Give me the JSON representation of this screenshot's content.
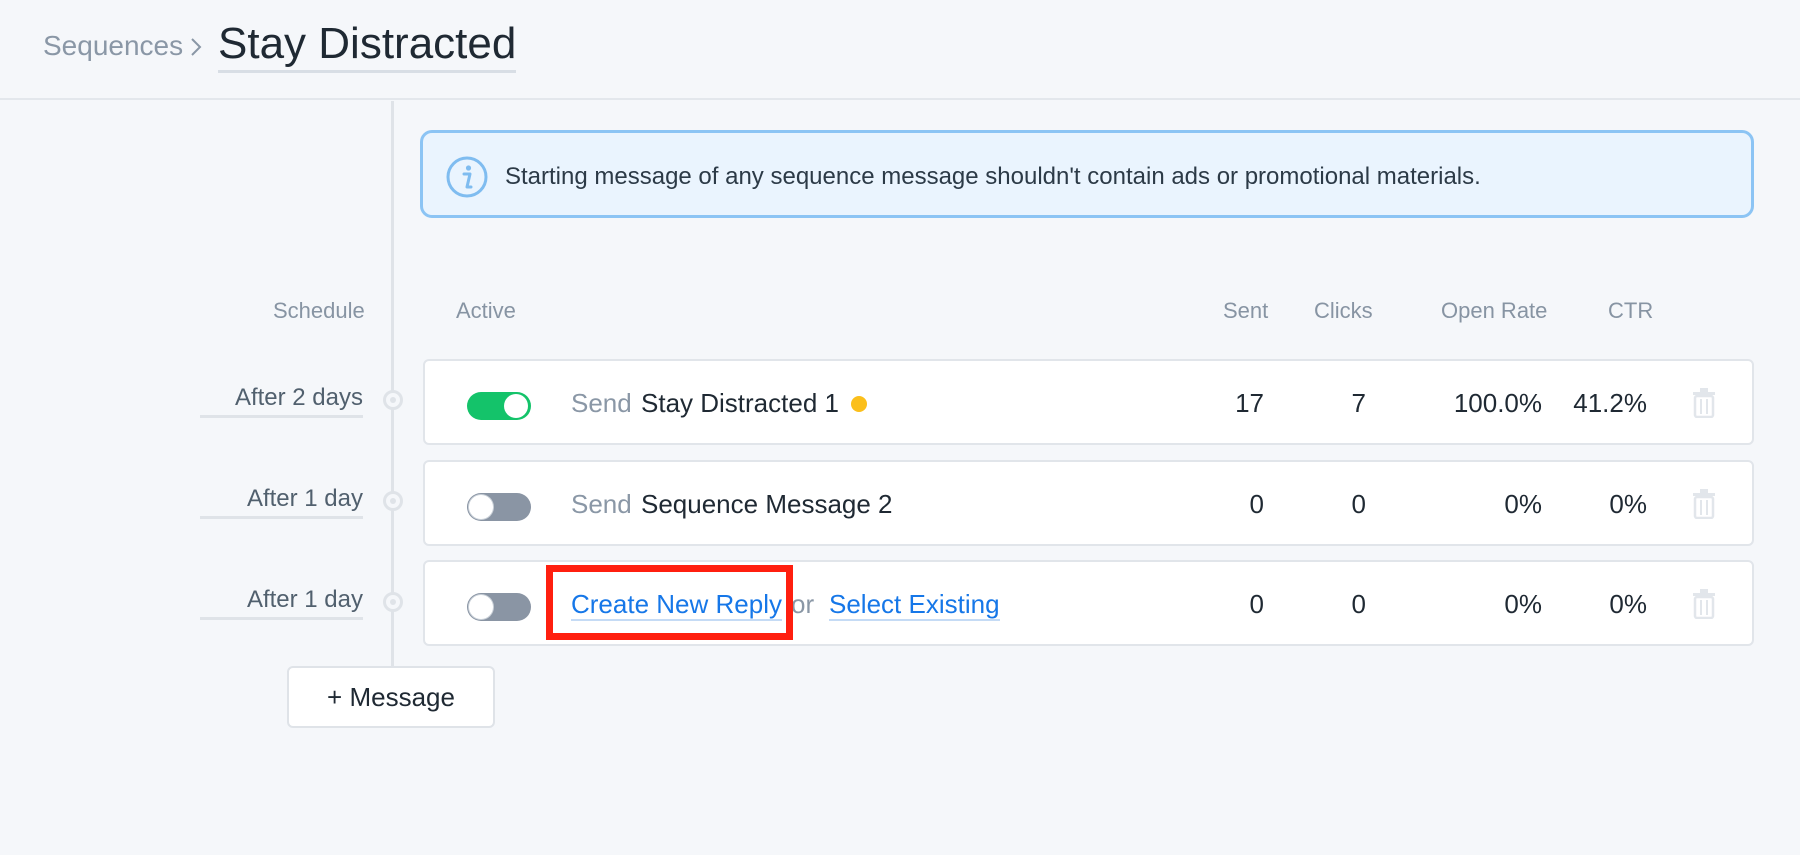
{
  "breadcrumb": {
    "parent": "Sequences",
    "title": "Stay Distracted"
  },
  "notice": {
    "text": "Starting message of any sequence message shouldn't contain ads or promotional materials."
  },
  "columns": {
    "schedule": "Schedule",
    "active": "Active",
    "sent": "Sent",
    "clicks": "Clicks",
    "open_rate": "Open Rate",
    "ctr": "CTR"
  },
  "rows": [
    {
      "schedule": "After 2 days",
      "active": true,
      "send_label": "Send",
      "message": "Stay Distracted 1",
      "sent": "17",
      "clicks": "7",
      "open_rate": "100.0%",
      "ctr": "41.2%"
    },
    {
      "schedule": "After 1 day",
      "active": false,
      "send_label": "Send",
      "message": "Sequence Message 2",
      "sent": "0",
      "clicks": "0",
      "open_rate": "0%",
      "ctr": "0%"
    },
    {
      "schedule": "After 1 day",
      "active": false,
      "create_label": "Create New Reply",
      "or_label": "or",
      "select_label": "Select Existing",
      "sent": "0",
      "clicks": "0",
      "open_rate": "0%",
      "ctr": "0%"
    }
  ],
  "add_message_label": "+ Message",
  "colors": {
    "accent": "#1677e8",
    "toggle_on": "#14c36a",
    "toggle_off": "#8a95a4",
    "status_dot": "#fbbf1b",
    "highlight": "#ff1f0f"
  }
}
